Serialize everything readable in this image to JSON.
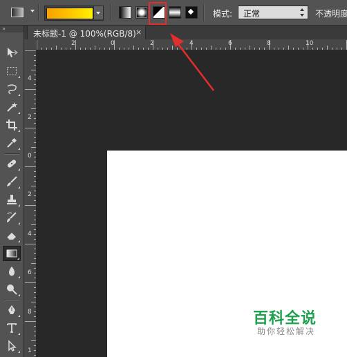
{
  "options_bar": {
    "gradient_colors": [
      "#f9a000",
      "#fdbd00",
      "#fff100"
    ],
    "gradient_types": [
      "linear-gradient",
      "radial-gradient",
      "angle-gradient",
      "reflected-gradient",
      "diamond-gradient"
    ],
    "selected_gradient_type": "radial-gradient",
    "highlighted_gradient_type": "angle-gradient",
    "mode_label": "模式:",
    "mode_value": "正常",
    "opacity_label": "不透明度"
  },
  "document": {
    "tab_title": "未标题-1 @ 100%(RGB/8)",
    "close_glyph": "×"
  },
  "rulers": {
    "horizontal_labels": [
      "2",
      "0",
      "2",
      "4",
      "6",
      "8",
      "10"
    ],
    "vertical_labels": [
      "4",
      "2",
      "0",
      "2",
      "4",
      "6",
      "8",
      "1"
    ]
  },
  "toolbar": {
    "grip": "»",
    "tools": [
      "move-tool",
      "marquee-tool",
      "lasso-tool",
      "magic-wand-tool",
      "crop-tool",
      "eyedropper-tool",
      "healing-brush-tool",
      "brush-tool",
      "clone-stamp-tool",
      "history-brush-tool",
      "eraser-tool",
      "gradient-tool",
      "blur-tool",
      "dodge-tool",
      "pen-tool",
      "type-tool",
      "path-selection-tool"
    ],
    "active_tool": "gradient-tool"
  },
  "annotation": {
    "highlight_color": "#e42d2d"
  },
  "watermark": {
    "title": "百科全说",
    "subtitle": "助你轻松解决",
    "color": "#1ea14e"
  }
}
